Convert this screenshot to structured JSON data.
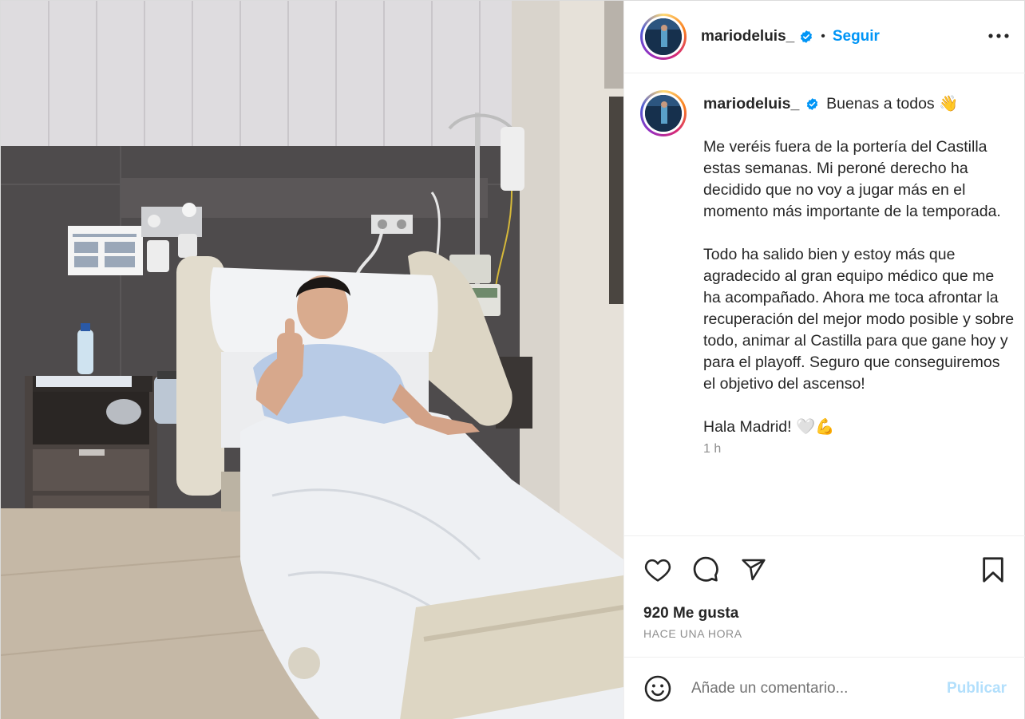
{
  "post": {
    "username": "mariodeluis_",
    "follow_label": "Seguir",
    "separator": "•",
    "caption": {
      "username": "mariodeluis_",
      "first_line": "Buenas a todos 👋",
      "paragraphs": [
        "Me veréis fuera de la portería del Castilla estas semanas. Mi peroné derecho ha decidido que no voy a jugar más en el momento más importante de la temporada.",
        "Todo ha salido bien y estoy más que agradecido al gran equipo médico que me ha acompañado. Ahora me toca afrontar la recuperación del mejor modo posible y sobre todo, animar al Castilla para que gane hoy y para el playoff. Seguro que conseguiremos el objetivo del ascenso!",
        "Hala Madrid! 🤍💪"
      ],
      "age": "1 h"
    },
    "likes": "920 Me gusta",
    "date": "HACE UNA HORA",
    "comment": {
      "placeholder": "Añade un comentario...",
      "publish_label": "Publicar"
    }
  },
  "icons": {
    "verified": "verified-badge-icon",
    "more": "more-options-icon",
    "like": "heart-icon",
    "comment": "comment-icon",
    "share": "send-icon",
    "save": "bookmark-icon",
    "emoji": "emoji-icon"
  },
  "colors": {
    "accent": "#0095f6",
    "publish_disabled": "#b2dffc",
    "secondary_text": "#8e8e8e"
  }
}
